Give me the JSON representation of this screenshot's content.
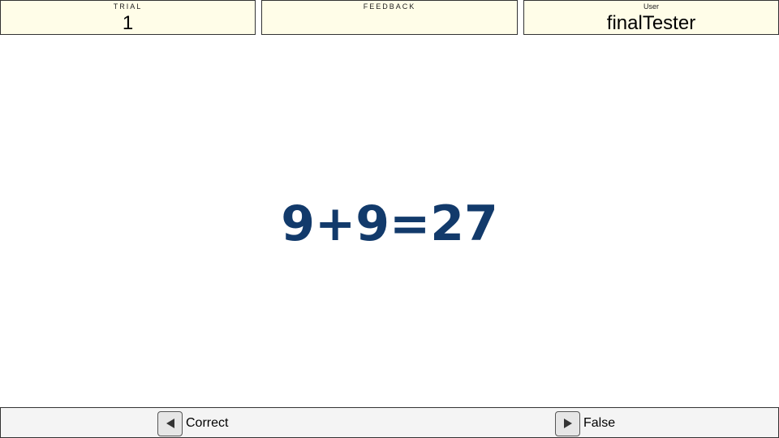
{
  "header": {
    "trial": {
      "label": "TRIAL",
      "value": "1"
    },
    "feedback": {
      "label": "FEEDBACK",
      "value": ""
    },
    "user": {
      "label": "User",
      "value": "finalTester"
    }
  },
  "stimulus": {
    "problem": "9+9=27",
    "color": "#123a6b"
  },
  "responses": {
    "correct": {
      "label": "Correct",
      "icon": "arrow-left-icon"
    },
    "false": {
      "label": "False",
      "icon": "arrow-right-icon"
    }
  }
}
